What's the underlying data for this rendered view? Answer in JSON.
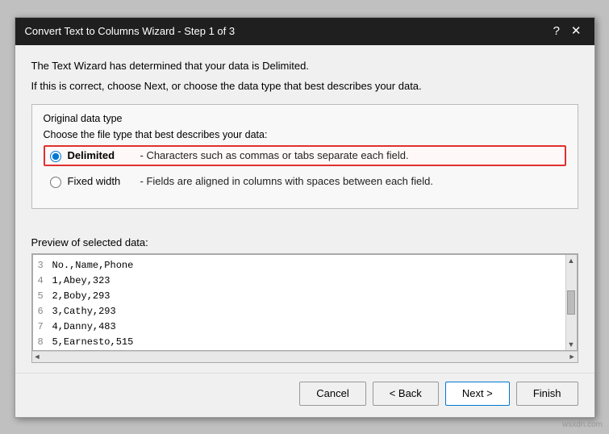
{
  "dialog": {
    "title": "Convert Text to Columns Wizard - Step 1 of 3",
    "help_icon": "?",
    "close_icon": "✕"
  },
  "intro": {
    "line1": "The Text Wizard has determined that your data is Delimited.",
    "line2": "If this is correct, choose Next, or choose the data type that best describes your data."
  },
  "original_data_type": {
    "label": "Original data type",
    "sub_label": "Choose the file type that best describes your data:",
    "options": [
      {
        "value": "delimited",
        "label": "Delimited",
        "description": "- Characters such as commas or tabs separate each field.",
        "selected": true
      },
      {
        "value": "fixed_width",
        "label": "Fixed width",
        "description": "- Fields are aligned in columns with spaces between each field.",
        "selected": false
      }
    ]
  },
  "preview": {
    "label": "Preview of selected data:",
    "rows": [
      {
        "num": "3",
        "text": "No.,Name,Phone"
      },
      {
        "num": "4",
        "text": "1,Abey,323"
      },
      {
        "num": "5",
        "text": "2,Boby,293"
      },
      {
        "num": "6",
        "text": "3,Cathy,293"
      },
      {
        "num": "7",
        "text": "4,Danny,483"
      },
      {
        "num": "8",
        "text": "5,Earnesto,515"
      }
    ]
  },
  "footer": {
    "cancel_label": "Cancel",
    "back_label": "< Back",
    "next_label": "Next >",
    "finish_label": "Finish"
  },
  "watermark": "wsxdn.com"
}
